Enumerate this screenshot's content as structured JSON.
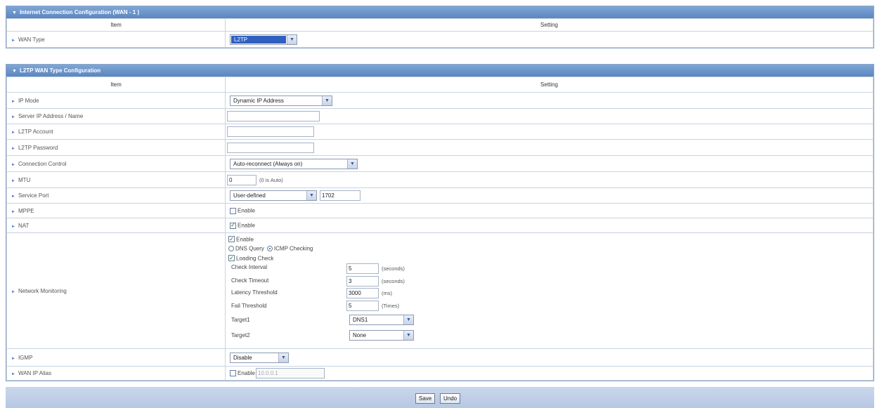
{
  "wan_panel": {
    "title": "Internet Connection Configuration (WAN - 1 )",
    "col_item": "Item",
    "col_setting": "Setting",
    "rows": {
      "wan_type": {
        "label": "WAN Type",
        "value": "L2TP"
      }
    }
  },
  "l2tp_panel": {
    "title": "L2TP WAN Type Configuration",
    "col_item": "Item",
    "col_setting": "Setting",
    "ip_mode": {
      "label": "IP Mode",
      "value": "Dynamic IP Address"
    },
    "server": {
      "label": "Server IP Address / Name",
      "value": ""
    },
    "account": {
      "label": "L2TP Account",
      "value": ""
    },
    "password": {
      "label": "L2TP Password",
      "value": ""
    },
    "connection_control": {
      "label": "Connection Control",
      "value": "Auto-reconnect (Always on)"
    },
    "mtu": {
      "label": "MTU",
      "value": "0",
      "hint": "(0 is Auto)"
    },
    "service_port": {
      "label": "Service Port",
      "mode": "User-defined",
      "port": "1702"
    },
    "mppe": {
      "label": "MPPE",
      "checkbox_label": "Enable",
      "checked": false
    },
    "nat": {
      "label": "NAT",
      "checkbox_label": "Enable",
      "checked": true
    },
    "network_monitoring": {
      "label": "Network Monitoring",
      "enable_label": "Enable",
      "dns_query_label": "DNS Query",
      "icmp_label": "ICMP Checking",
      "loading_check_label": "Loading Check",
      "check_interval_label": "Check Interval",
      "check_interval_value": "5",
      "check_interval_unit": "(seconds)",
      "check_timeout_label": "Check Timeout",
      "check_timeout_value": "3",
      "check_timeout_unit": "(seconds)",
      "latency_label": "Latency Threshold",
      "latency_value": "3000",
      "latency_unit": "(ms)",
      "fail_label": "Fail Threshold",
      "fail_value": "5",
      "fail_unit": "(Times)",
      "target1_label": "Target1",
      "target1_value": "DNS1",
      "target2_label": "Target2",
      "target2_value": "None"
    },
    "igmp": {
      "label": "IGMP",
      "value": "Disable"
    },
    "wan_ip_alias": {
      "label": "WAN IP Alias",
      "checkbox_label": "Enable",
      "placeholder": "10.0.0.1"
    }
  },
  "footer": {
    "save_label": "Save",
    "undo_label": "Undo"
  }
}
